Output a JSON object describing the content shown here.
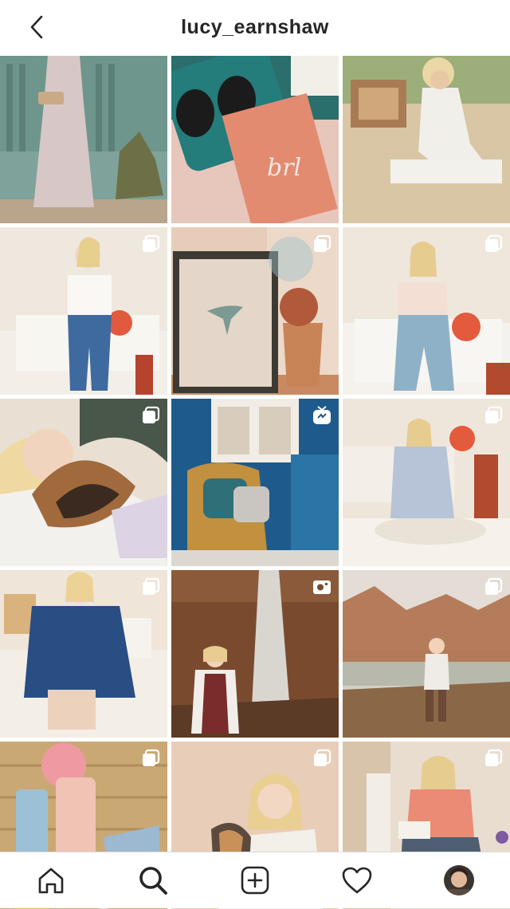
{
  "header": {
    "username": "lucy_earnshaw"
  },
  "colors": {
    "text": "#262626",
    "border": "#dbdbdb"
  },
  "posts": [
    {
      "id": 1,
      "badge": "none",
      "palette": [
        "#7fa39a",
        "#c8b7b1"
      ]
    },
    {
      "id": 2,
      "badge": "none",
      "palette": [
        "#2c7a7b",
        "#e38b70"
      ]
    },
    {
      "id": 3,
      "badge": "none",
      "palette": [
        "#d8c6a4",
        "#9bb67e"
      ]
    },
    {
      "id": 4,
      "badge": "carousel",
      "palette": [
        "#efe8df",
        "#3f6aa0"
      ]
    },
    {
      "id": 5,
      "badge": "carousel",
      "palette": [
        "#e7cdb9",
        "#7b5040"
      ]
    },
    {
      "id": 6,
      "badge": "carousel",
      "palette": [
        "#efe7dc",
        "#8fb1c7"
      ]
    },
    {
      "id": 7,
      "badge": "carousel",
      "palette": [
        "#e6dfd1",
        "#a06a3d"
      ]
    },
    {
      "id": 8,
      "badge": "igtv",
      "palette": [
        "#1e5b8c",
        "#c2903e"
      ]
    },
    {
      "id": 9,
      "badge": "carousel",
      "palette": [
        "#efe6db",
        "#b7c3d6"
      ]
    },
    {
      "id": 10,
      "badge": "carousel",
      "palette": [
        "#efe5d8",
        "#284e84"
      ]
    },
    {
      "id": 11,
      "badge": "video",
      "palette": [
        "#7a4a2f",
        "#d8d6cf"
      ]
    },
    {
      "id": 12,
      "badge": "carousel",
      "palette": [
        "#d6cfc6",
        "#a9643d"
      ]
    },
    {
      "id": 13,
      "badge": "carousel",
      "palette": [
        "#caa874",
        "#9cc1d6"
      ]
    },
    {
      "id": 14,
      "badge": "carousel",
      "palette": [
        "#e8cdb9",
        "#f3efe9"
      ]
    },
    {
      "id": 15,
      "badge": "carousel",
      "palette": [
        "#e9ddd0",
        "#ea8b76"
      ]
    }
  ],
  "nav": {
    "items": [
      "home",
      "search",
      "new-post",
      "activity",
      "profile"
    ]
  }
}
